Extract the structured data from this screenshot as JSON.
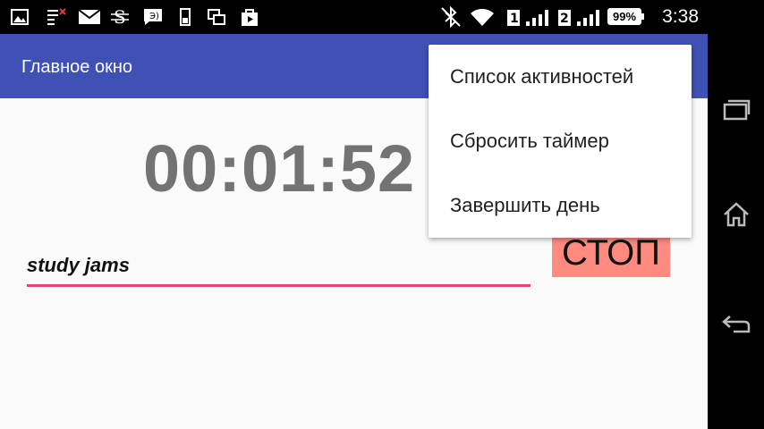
{
  "status_bar": {
    "time": "3:38",
    "battery": "99%",
    "sim1": "1",
    "sim2": "2",
    "icons": [
      "gallery-icon",
      "signal-strikethrough-icon",
      "mail-icon",
      "s-app-icon",
      "chat-icon",
      "phone-usage-icon",
      "windows-icon",
      "play-store-icon",
      "bluetooth-off-icon",
      "wifi-icon",
      "sim1-signal-icon",
      "sim2-signal-icon",
      "battery-icon"
    ]
  },
  "app": {
    "title": "Главное окно",
    "timer": "00:01:52",
    "activity_value": "study jams",
    "stop_label": "СТОП"
  },
  "menu": {
    "items": [
      {
        "label": "Список активностей"
      },
      {
        "label": "Сбросить таймер"
      },
      {
        "label": "Завершить день"
      }
    ]
  },
  "navbar": {
    "buttons": [
      "recent-apps-icon",
      "home-icon",
      "back-icon"
    ]
  },
  "colors": {
    "toolbar": "#3f51b5",
    "accent": "#e0457b",
    "stop_button": "#ff8a80"
  }
}
